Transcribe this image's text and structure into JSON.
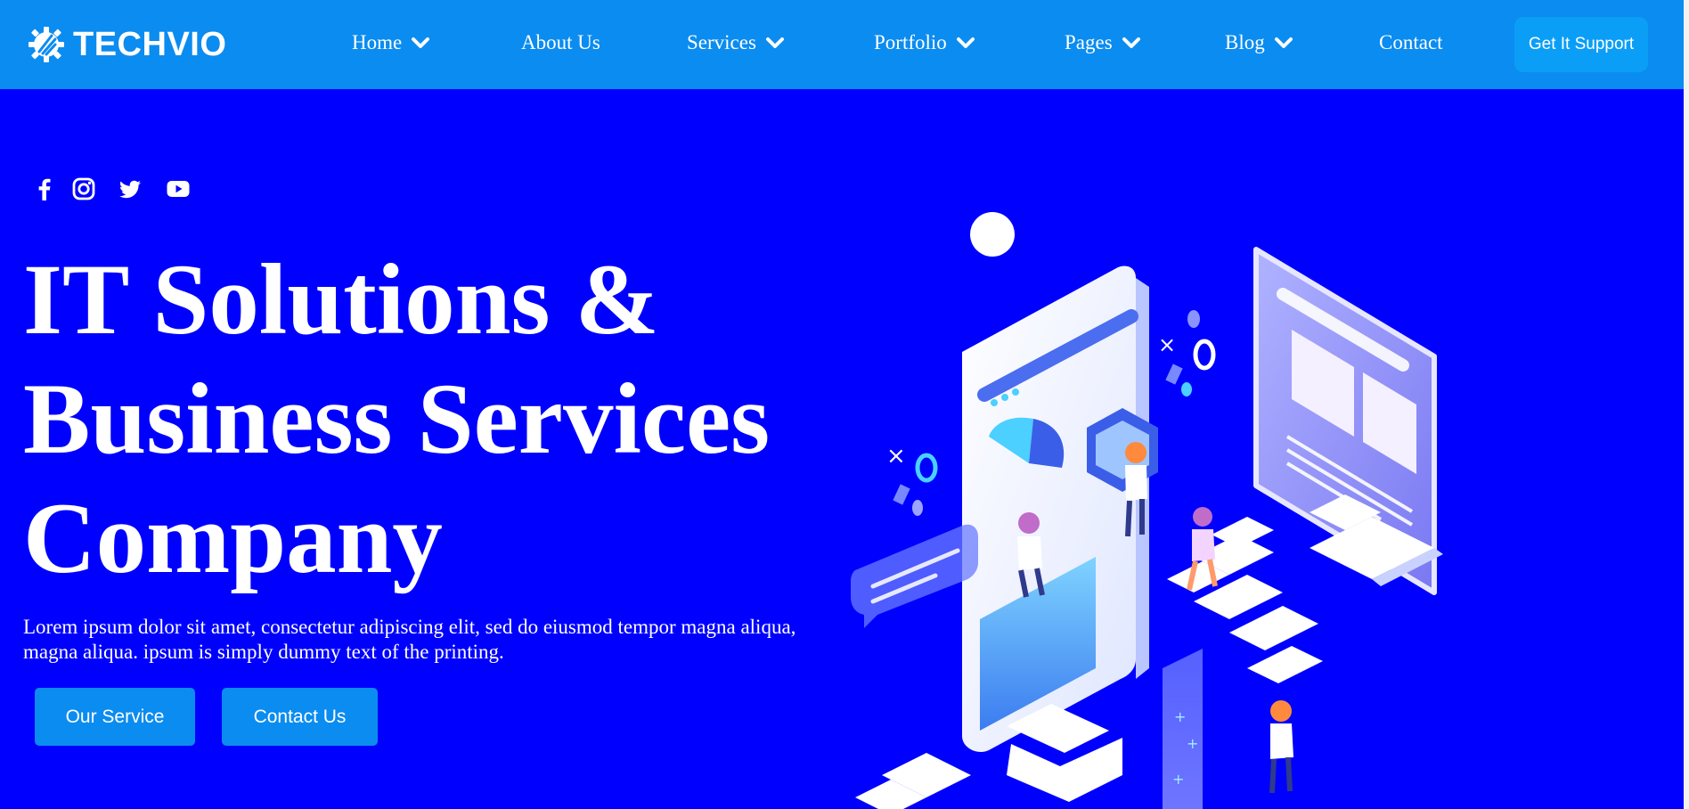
{
  "brand": {
    "name": "TECHVIO"
  },
  "nav": {
    "items": [
      {
        "label": "Home",
        "has_dropdown": true
      },
      {
        "label": "About Us",
        "has_dropdown": false
      },
      {
        "label": "Services",
        "has_dropdown": true
      },
      {
        "label": "Portfolio",
        "has_dropdown": true
      },
      {
        "label": "Pages",
        "has_dropdown": true
      },
      {
        "label": "Blog",
        "has_dropdown": true
      },
      {
        "label": "Contact",
        "has_dropdown": false
      }
    ],
    "cta_label": "Get It Support"
  },
  "social": [
    "facebook-icon",
    "instagram-icon",
    "twitter-icon",
    "youtube-icon"
  ],
  "hero": {
    "title_lines": [
      "IT Solutions &",
      "Business Services",
      "Company"
    ],
    "description": "Lorem ipsum dolor sit amet, consectetur adipiscing elit, sed do eiusmod tempor magna aliqua, magna aliqua. ipsum is simply dummy text of the printing.",
    "primary_button": "Our Service",
    "secondary_button": "Contact Us"
  },
  "colors": {
    "hero_bg": "#0000ff",
    "nav_bg": "#0b8cf0",
    "button_bg": "#0b8cf0",
    "support_button_bg": "#0a9ef7"
  }
}
